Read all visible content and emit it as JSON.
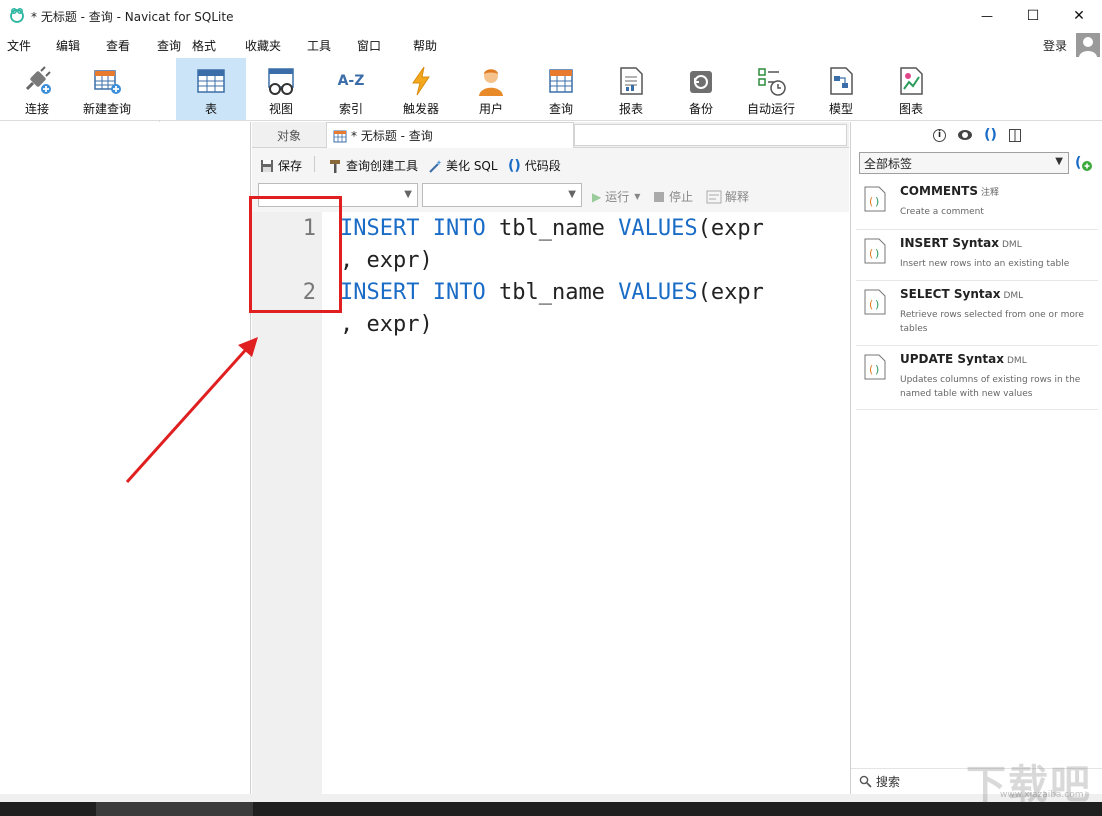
{
  "window": {
    "title": "* 无标题 - 查询 - Navicat for SQLite",
    "minimize": "—",
    "maximize": "☐",
    "close": "✕"
  },
  "menu": {
    "items": [
      "文件",
      "编辑",
      "查看",
      "查询",
      "格式",
      "收藏夹",
      "工具",
      "窗口",
      "帮助"
    ],
    "login": "登录"
  },
  "toolbar": {
    "buttons": [
      {
        "label": "连接",
        "icon": "plug-connect-icon"
      },
      {
        "label": "新建查询",
        "icon": "new-query-icon"
      },
      {
        "label": "表",
        "icon": "table-icon",
        "active": true
      },
      {
        "label": "视图",
        "icon": "view-glasses-icon"
      },
      {
        "label": "索引",
        "icon": "index-az-icon",
        "glyph": "A-Z"
      },
      {
        "label": "触发器",
        "icon": "trigger-bolt-icon"
      },
      {
        "label": "用户",
        "icon": "user-icon"
      },
      {
        "label": "查询",
        "icon": "query-icon"
      },
      {
        "label": "报表",
        "icon": "report-icon"
      },
      {
        "label": "备份",
        "icon": "backup-icon"
      },
      {
        "label": "自动运行",
        "icon": "auto-run-icon"
      },
      {
        "label": "模型",
        "icon": "model-icon"
      },
      {
        "label": "图表",
        "icon": "chart-icon"
      }
    ]
  },
  "tabs": {
    "objects": "对象",
    "query": "* 无标题 - 查询"
  },
  "editor_toolbar": {
    "save": "保存",
    "query_builder": "查询创建工具",
    "beautify": "美化 SQL",
    "snippet": "代码段",
    "run": "运行",
    "stop": "停止",
    "explain": "解释"
  },
  "editor": {
    "lines": [
      {
        "number": "1",
        "row1": {
          "kw1": "INSERT",
          "kw2": "INTO",
          "ident": "tbl_name",
          "kw3": "VALUES",
          "rest": "(expr"
        },
        "row2": ", expr)"
      },
      {
        "number": "2",
        "row1": {
          "kw1": "INSERT",
          "kw2": "INTO",
          "ident": "tbl_name",
          "kw3": "VALUES",
          "rest": "(expr"
        },
        "row2": ", expr)"
      }
    ]
  },
  "right_pane": {
    "tag_filter": "全部标签",
    "search_placeholder": "搜索",
    "snippets": [
      {
        "title": "COMMENTS",
        "type": "注释",
        "desc": "Create a comment"
      },
      {
        "title": "INSERT Syntax",
        "type": "DML",
        "desc": "Insert new rows into an existing table"
      },
      {
        "title": "SELECT Syntax",
        "type": "DML",
        "desc": "Retrieve rows selected from one or more tables"
      },
      {
        "title": "UPDATE Syntax",
        "type": "DML",
        "desc": "Updates columns of existing rows in the named table with new values"
      }
    ]
  },
  "watermark": {
    "main": "下载吧",
    "sub": "www.xiazaiba.com"
  },
  "colors": {
    "keyword": "#1a6cc7",
    "annotation": "#e02020",
    "active_tab": "#cce4f7"
  }
}
